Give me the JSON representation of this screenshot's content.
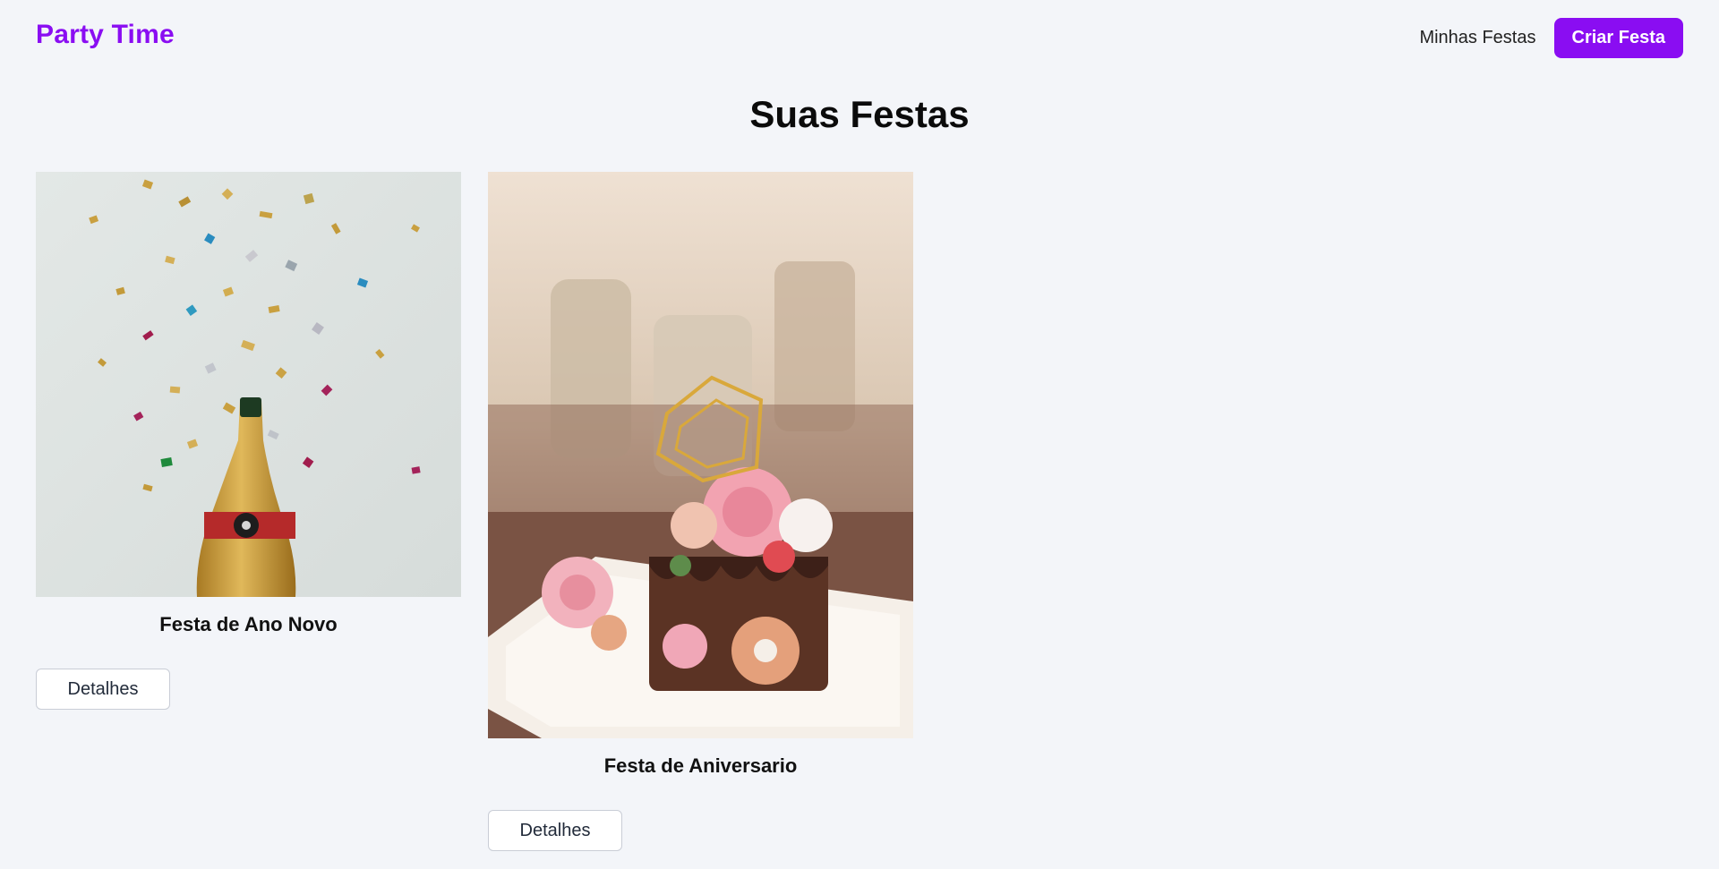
{
  "header": {
    "brand": "Party Time",
    "nav_link": "Minhas Festas",
    "create_button": "Criar Festa"
  },
  "main": {
    "title": "Suas Festas",
    "parties": [
      {
        "name": "Festa de Ano Novo",
        "details_label": "Detalhes"
      },
      {
        "name": "Festa de Aniversario",
        "details_label": "Detalhes"
      }
    ]
  },
  "colors": {
    "accent": "#8a0df2",
    "background": "#f3f5f9"
  }
}
